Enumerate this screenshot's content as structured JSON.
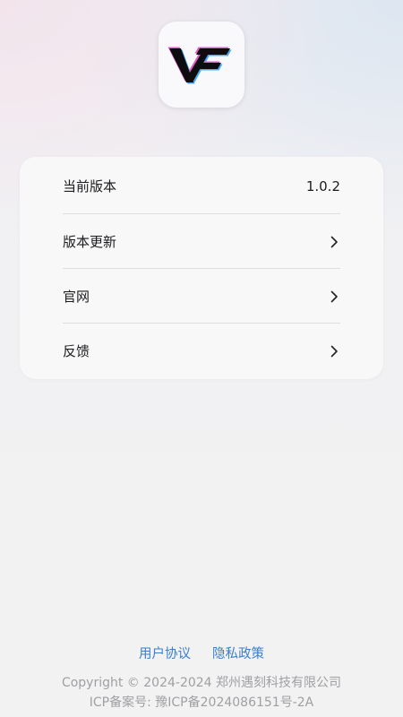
{
  "app": {
    "logo_icon": "vf-logo-icon",
    "accent_color": "#3a7fd0"
  },
  "info_card": {
    "items": [
      {
        "label": "当前版本",
        "value": "1.0.2",
        "icon": ""
      },
      {
        "label": "版本更新",
        "value": "",
        "icon": "chevron-right-icon"
      },
      {
        "label": "官网",
        "value": "",
        "icon": "chevron-right-icon"
      },
      {
        "label": "反馈",
        "value": "",
        "icon": "chevron-right-icon"
      }
    ]
  },
  "footer": {
    "user_agreement": "用户协议",
    "privacy_policy": "隐私政策",
    "copyright": "Copyright © 2024-2024 郑州遇刻科技有限公司",
    "icp": "ICP备案号: 豫ICP备2024086151号-2A"
  }
}
